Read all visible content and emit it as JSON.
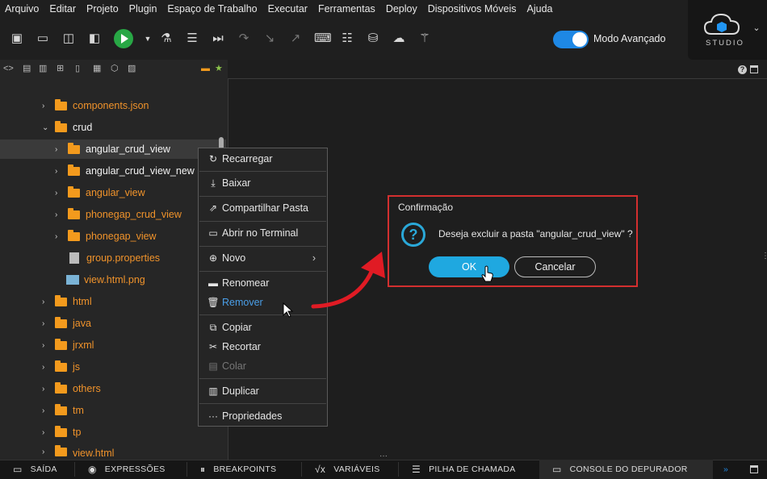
{
  "menu": [
    "Arquivo",
    "Editar",
    "Projeto",
    "Plugin",
    "Espaço de Trabalho",
    "Executar",
    "Ferramentas",
    "Deploy",
    "Dispositivos Móveis",
    "Ajuda"
  ],
  "toolbar": {
    "advanced_mode_label": "Modo Avançado",
    "studio_label": "STUDIO"
  },
  "tree": [
    {
      "label": "components.json",
      "kind": "folder",
      "color": "orange",
      "expanded": false
    },
    {
      "label": "crud",
      "kind": "folder",
      "color": "white",
      "expanded": true
    },
    {
      "label": "angular_crud_view",
      "kind": "folder",
      "color": "white",
      "expanded": false,
      "selected": true
    },
    {
      "label": "angular_crud_view_new",
      "kind": "folder",
      "color": "white",
      "expanded": false
    },
    {
      "label": "angular_view",
      "kind": "folder",
      "color": "orange",
      "expanded": false
    },
    {
      "label": "phonegap_crud_view",
      "kind": "folder",
      "color": "orange",
      "expanded": false
    },
    {
      "label": "phonegap_view",
      "kind": "folder",
      "color": "orange",
      "expanded": false
    },
    {
      "label": "group.properties",
      "kind": "file",
      "color": "orange"
    },
    {
      "label": "view.html.png",
      "kind": "image",
      "color": "orange"
    },
    {
      "label": "html",
      "kind": "folder",
      "color": "orange",
      "expanded": false
    },
    {
      "label": "java",
      "kind": "folder",
      "color": "orange",
      "expanded": false
    },
    {
      "label": "jrxml",
      "kind": "folder",
      "color": "orange",
      "expanded": false
    },
    {
      "label": "js",
      "kind": "folder",
      "color": "orange",
      "expanded": false
    },
    {
      "label": "others",
      "kind": "folder",
      "color": "orange",
      "expanded": false
    },
    {
      "label": "tm",
      "kind": "folder",
      "color": "orange",
      "expanded": false
    },
    {
      "label": "tp",
      "kind": "folder",
      "color": "orange",
      "expanded": false
    },
    {
      "label": "view.html",
      "kind": "folder",
      "color": "orange",
      "expanded": false
    }
  ],
  "context_menu": {
    "reload": "Recarregar",
    "download": "Baixar",
    "share": "Compartilhar Pasta",
    "terminal": "Abrir no Terminal",
    "new": "Novo",
    "rename": "Renomear",
    "remove": "Remover",
    "copy": "Copiar",
    "cut": "Recortar",
    "paste": "Colar",
    "duplicate": "Duplicar",
    "properties": "Propriedades"
  },
  "dialog": {
    "title": "Confirmação",
    "message": "Deseja excluir a pasta \"angular_crud_view\" ?",
    "ok": "OK",
    "cancel": "Cancelar"
  },
  "bottom_tabs": {
    "output": "SAÍDA",
    "expressions": "EXPRESSÕES",
    "breakpoints": "BREAKPOINTS",
    "variables": "VARIÁVEIS",
    "call_stack": "PILHA DE CHAMADA",
    "debug_console": "CONSOLE DO DEPURADOR"
  },
  "colors": {
    "accent": "#1fa8e0",
    "folder": "#f39a1d",
    "highlight_border": "#d32f2f",
    "remove_text": "#4a9fe8"
  }
}
